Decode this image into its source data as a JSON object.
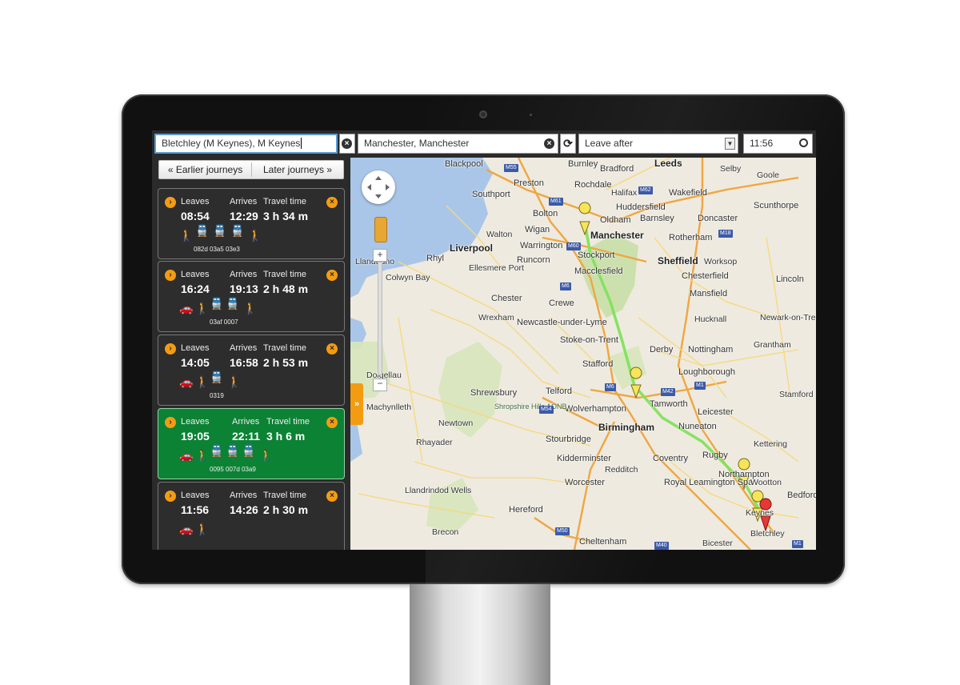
{
  "search": {
    "from_value": "Bletchley (M Keynes), M Keynes",
    "to_value": "Manchester, Manchester",
    "mode_value": "Leave after",
    "time_value": "11:56",
    "clear_glyph": "×",
    "swap_glyph": "⟳",
    "select_glyph": "▼"
  },
  "nav": {
    "earlier_label": "« Earlier journeys",
    "later_label": "Later journeys »"
  },
  "labels": {
    "leaves": "Leaves",
    "arrives": "Arrives",
    "travel_time": "Travel time",
    "chevron_glyph": "›",
    "remove_glyph": "×"
  },
  "journeys": [
    {
      "leaves": "08:54",
      "arrives": "12:29",
      "travel_time": "3 h 34 m",
      "codes": "082d 03a5 03e3",
      "selected": false
    },
    {
      "leaves": "16:24",
      "arrives": "19:13",
      "travel_time": "2 h 48 m",
      "codes": "03af 0007",
      "selected": false
    },
    {
      "leaves": "14:05",
      "arrives": "16:58",
      "travel_time": "2 h 53 m",
      "codes": "0319",
      "selected": false
    },
    {
      "leaves": "19:05",
      "arrives": "22:11",
      "travel_time": "3 h 6 m",
      "codes": "0095 007d 03a9",
      "selected": true
    },
    {
      "leaves": "11:56",
      "arrives": "14:26",
      "travel_time": "2 h 30 m",
      "codes": "",
      "selected": false
    }
  ],
  "map": {
    "collapse_glyph": "»",
    "zoom_in": "+",
    "zoom_out": "−",
    "places": {
      "blackpool": "Blackpool",
      "burnley": "Burnley",
      "bradford": "Bradford",
      "leeds": "Leeds",
      "selby": "Selby",
      "rochdale": "Rochdale",
      "halifax": "Halifax",
      "wakefield": "Wakefield",
      "goole": "Goole",
      "southport": "Southport",
      "bolton": "Bolton",
      "oldham": "Oldham",
      "huddersfield": "Huddersfield",
      "barnsley": "Barnsley",
      "doncaster": "Doncaster",
      "scunthorpe": "Scunthorpe",
      "preston": "Preston",
      "wigan": "Wigan",
      "manchester": "Manchester",
      "walton": "Walton",
      "rotherham": "Rotherham",
      "liverpool": "Liverpool",
      "warrington": "Warrington",
      "stockport": "Stockport",
      "sheffield": "Sheffield",
      "worksop": "Worksop",
      "rhyl": "Rhyl",
      "llandudno": "Llandudno",
      "runcorn": "Runcorn",
      "macclesfield": "Macclesfield",
      "colwyn_bay": "Colwyn Bay",
      "ellesmere_port": "Ellesmere Port",
      "chesterfield": "Chesterfield",
      "lincoln": "Lincoln",
      "mansfield": "Mansfield",
      "crewe": "Crewe",
      "chester": "Chester",
      "wrexham": "Wrexham",
      "newcastle": "Newcastle-under-Lyme",
      "hucknall": "Hucknall",
      "newark": "Newark-on-Trent",
      "stoke": "Stoke-on-Trent",
      "derby": "Derby",
      "nottingham": "Nottingham",
      "grantham": "Grantham",
      "stafford": "Stafford",
      "loughborough": "Loughborough",
      "dolgellau": "Dolgellau",
      "shrewsbury": "Shrewsbury",
      "telford": "Telford",
      "tamworth": "Tamworth",
      "stamford": "Stamford",
      "wolverhampton": "Wolverhampton",
      "leicester": "Leicester",
      "machynlleth": "Machynlleth",
      "shropshire": "Shropshire Hills AONB",
      "newtown": "Newtown",
      "birmingham": "Birmingham",
      "nuneaton": "Nuneaton",
      "stourbridge": "Stourbridge",
      "kettering": "Kettering",
      "kidderminster": "Kidderminster",
      "coventry": "Coventry",
      "rugby": "Rugby",
      "rhayader": "Rhayader",
      "redditch": "Redditch",
      "northampton": "Northampton",
      "worcester": "Worcester",
      "royal_leamington_spa": "Royal Leamington Spa",
      "llandrindod_wells": "Llandrindod Wells",
      "wootton": "Wootton",
      "bedford": "Bedford",
      "hereford": "Hereford",
      "milton_keynes": "Keynes",
      "brecon": "Brecon",
      "cheltenham": "Cheltenham",
      "bicester": "Bicester",
      "bletchley": "Bletchley"
    },
    "roads": {
      "m55": "M55",
      "m62": "M62",
      "m61": "M61",
      "m60": "M60",
      "m6a": "M6",
      "m6b": "M6",
      "m1a": "M1",
      "m1b": "M1",
      "m18": "M18",
      "m42": "M42",
      "m54": "M54",
      "m50": "M50",
      "m40": "M40"
    },
    "colors": {
      "sea": "#a9c6e8",
      "land": "#eeeadf",
      "park": "#c8dfa8",
      "route": "#7ee35a",
      "motorway": "#f0a640",
      "road": "#f7d87a",
      "marker": "#f6e55a",
      "dest_marker": "#e53935"
    }
  }
}
